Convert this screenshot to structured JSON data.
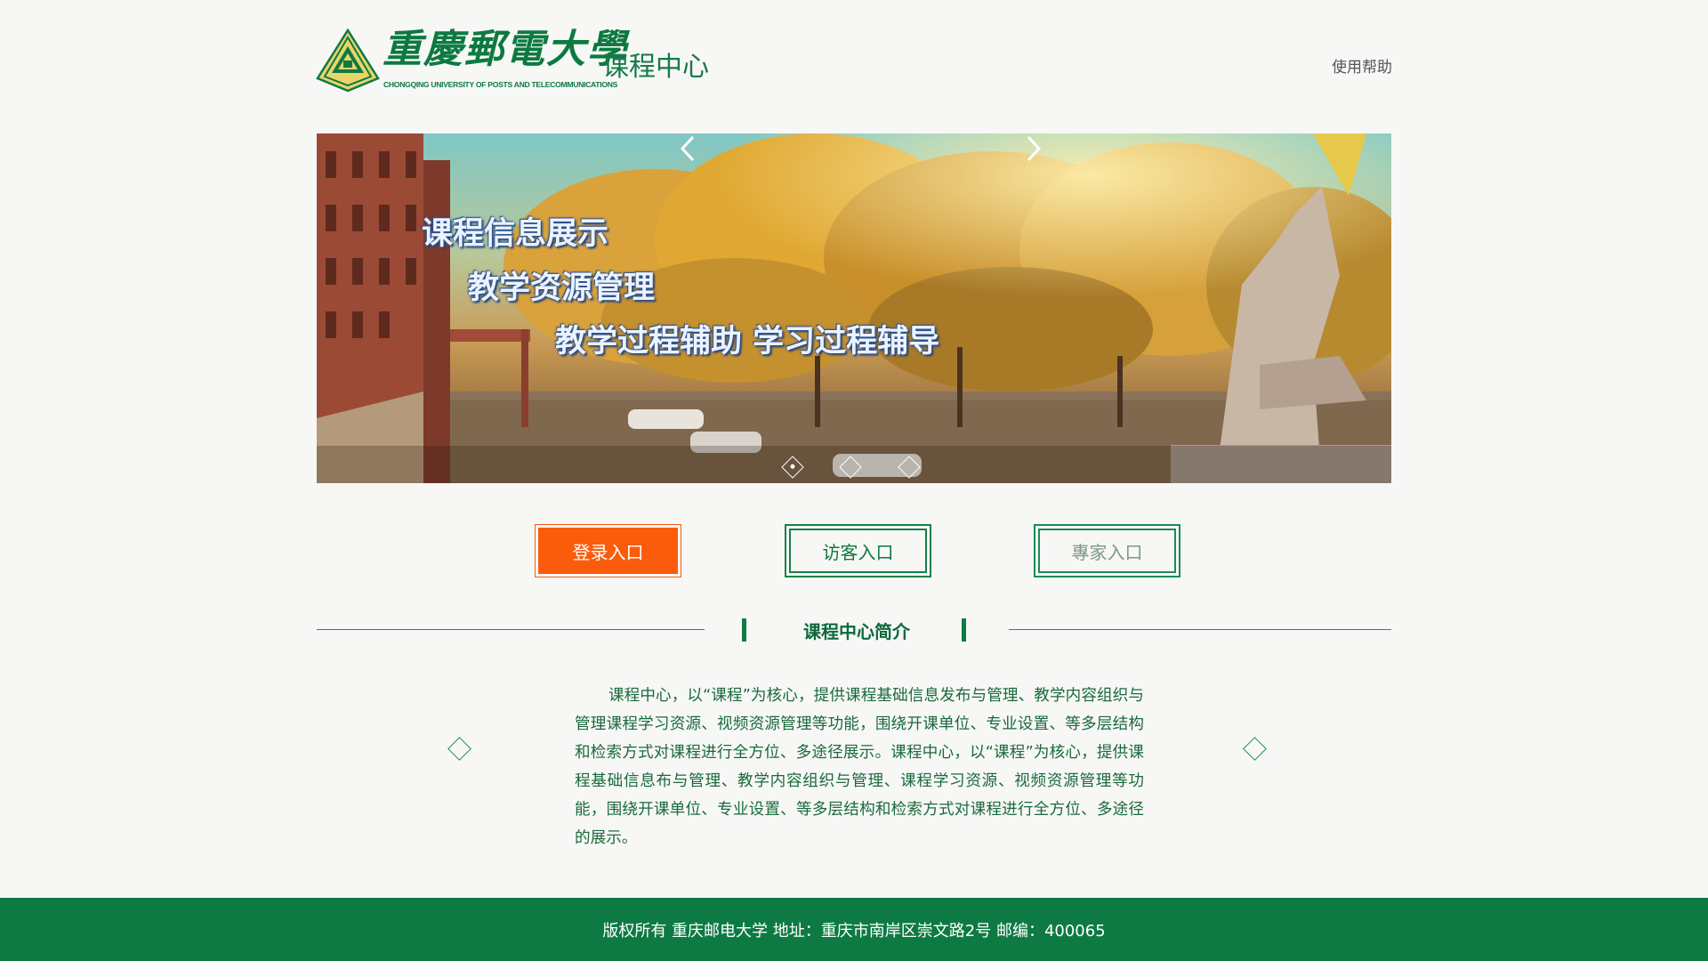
{
  "header": {
    "logo_chinese": "重慶郵電大學",
    "logo_english": "CHONGQING UNIVERSITY OF POSTS AND TELECOMMUNICATIONS",
    "site_title": "课程中心",
    "help_link": "使用帮助"
  },
  "banner": {
    "lines": [
      "课程信息展示",
      "教学资源管理",
      "教学过程辅助  学习过程辅导"
    ],
    "slide_count": 3,
    "active_slide": 1
  },
  "entries": {
    "login": "登录入口",
    "guest": "访客入口",
    "expert": "專家入口"
  },
  "section": {
    "title": "课程中心简介",
    "intro": "课程中心，以“课程”为核心，提供课程基础信息发布与管理、教学内容组织与管理课程学习资源、视频资源管理等功能，围绕开课单位、专业设置、等多层结构和检索方式对课程进行全方位、多途径展示。课程中心，以“课程”为核心，提供课程基础信息布与管理、教学内容组织与管理、课程学习资源、视频资源管理等功能，围绕开课单位、专业设置、等多层结构和检索方式对课程进行全方位、多途径的展示。"
  },
  "footer": {
    "text": "版权所有 重庆邮电大学 地址：重庆市南岸区崇文路2号 邮编：400065"
  },
  "colors": {
    "brand_green": "#0e7a43",
    "login_orange": "#fa5c0c",
    "background": "#f7f7f6"
  },
  "icons": [
    "university-emblem-icon",
    "arrow-left-icon",
    "arrow-right-icon",
    "diamond-icon"
  ]
}
